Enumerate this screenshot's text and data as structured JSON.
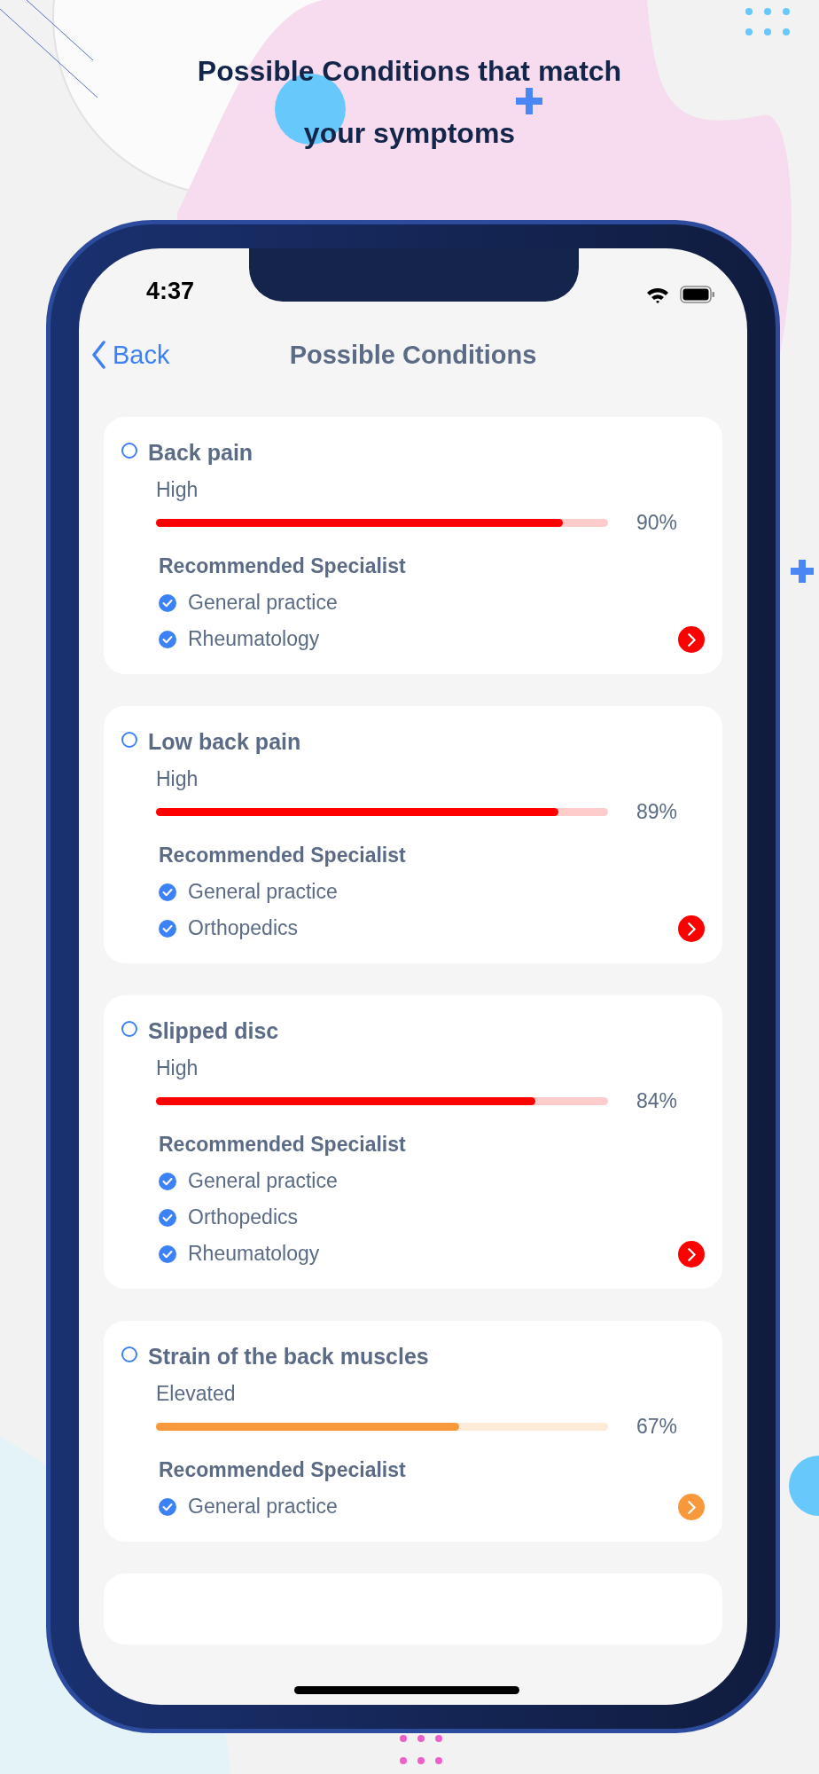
{
  "headline": {
    "lines": [
      "Possible Conditions that match",
      "your symptoms"
    ]
  },
  "status_bar": {
    "time": "4:37"
  },
  "nav": {
    "back": "Back",
    "title": "Possible Conditions"
  },
  "conditions": [
    {
      "name": "Back pain",
      "selected": false,
      "severity": "High",
      "level": 0.9,
      "percent": "90%",
      "color": "#ff0000",
      "specialist_heading": "Recommended Specialist",
      "specialists": [
        {
          "label": "General practice",
          "checked": true
        },
        {
          "label": "Rheumatology",
          "checked": true
        }
      ]
    },
    {
      "name": "Low back pain",
      "selected": false,
      "severity": "High",
      "level": 0.89,
      "percent": "89%",
      "color": "#ff0000",
      "specialist_heading": "Recommended Specialist",
      "specialists": [
        {
          "label": "General practice",
          "checked": true
        },
        {
          "label": "Orthopedics",
          "checked": true
        }
      ]
    },
    {
      "name": "Slipped disc",
      "selected": false,
      "severity": "High",
      "level": 0.84,
      "percent": "84%",
      "color": "#ff0000",
      "specialist_heading": "Recommended Specialist",
      "specialists": [
        {
          "label": "General practice",
          "checked": true
        },
        {
          "label": "Orthopedics",
          "checked": true
        },
        {
          "label": "Rheumatology",
          "checked": true
        }
      ]
    },
    {
      "name": "Strain of the back muscles",
      "selected": false,
      "severity": "Elevated",
      "level": 0.67,
      "percent": "67%",
      "color": "#f7993a",
      "specialist_heading": "Recommended Specialist",
      "specialists": [
        {
          "label": "General practice",
          "checked": true
        }
      ]
    }
  ]
}
